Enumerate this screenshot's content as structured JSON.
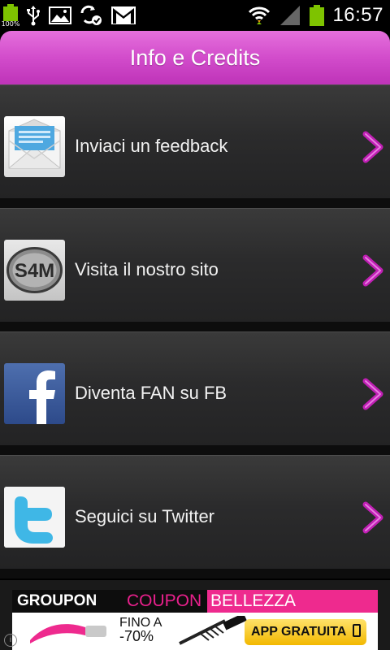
{
  "status_bar": {
    "battery_left_percent": "100%",
    "time": "16:57",
    "icons": [
      "battery-full-icon",
      "usb-icon",
      "gallery-icon",
      "sync-check-icon",
      "gmail-icon",
      "wifi-icon",
      "signal-icon",
      "battery-icon"
    ]
  },
  "header": {
    "title": "Info e Credits"
  },
  "menu": {
    "items": [
      {
        "label": "Inviaci un feedback",
        "icon": "email-envelope-icon"
      },
      {
        "label": "Visita il nostro sito",
        "icon": "s4m-logo-icon",
        "icon_text": "S4M"
      },
      {
        "label": "Diventa FAN su FB",
        "icon": "facebook-icon"
      },
      {
        "label": "Seguici su Twitter",
        "icon": "twitter-icon"
      }
    ],
    "arrow_icon": "chevron-right-icon"
  },
  "ad": {
    "brand": "GROUPON",
    "coupon": "COUPON",
    "category": "BELLEZZA",
    "discount_line1": "FINO A",
    "discount_line2": "-70%",
    "cta": "APP GRATUITA",
    "info": "i"
  },
  "colors": {
    "header_accent": "#d24ccb",
    "arrow": "#c01fb4",
    "item_bg": "#2b2b2c",
    "battery_green": "#7ec300",
    "ad_pink": "#ee2a8e"
  }
}
